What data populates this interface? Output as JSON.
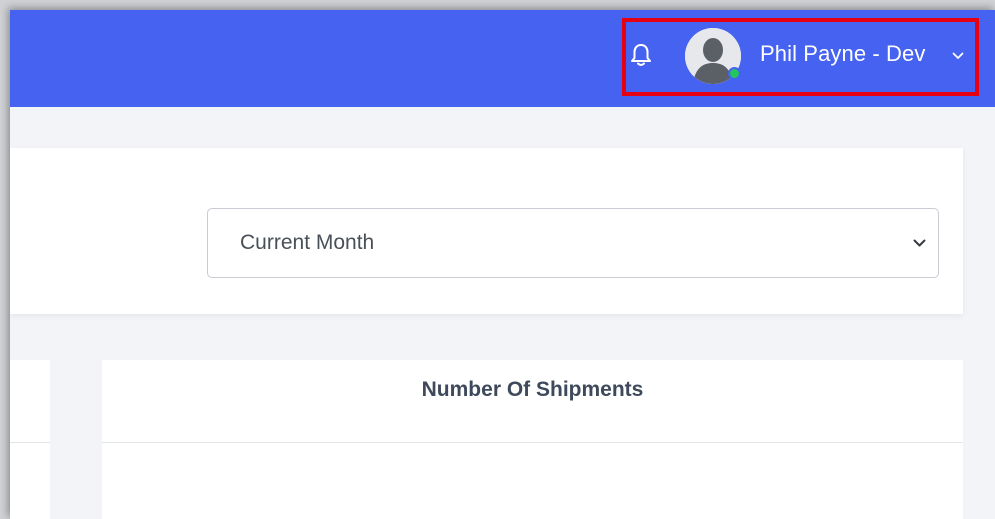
{
  "header": {
    "notification_icon": "bell-icon",
    "user": {
      "name": "Phil Payne - Dev",
      "avatar_icon": "user-avatar-icon",
      "status": "online",
      "status_color": "#22c55e",
      "dropdown_icon": "chevron-down-icon"
    },
    "colors": {
      "bar": "#4562f0",
      "highlight": "#e60012"
    }
  },
  "filter": {
    "period_select": {
      "value": "Current Month",
      "icon": "chevron-down-icon"
    }
  },
  "cards": {
    "shipments": {
      "title": "Number Of Shipments"
    }
  }
}
